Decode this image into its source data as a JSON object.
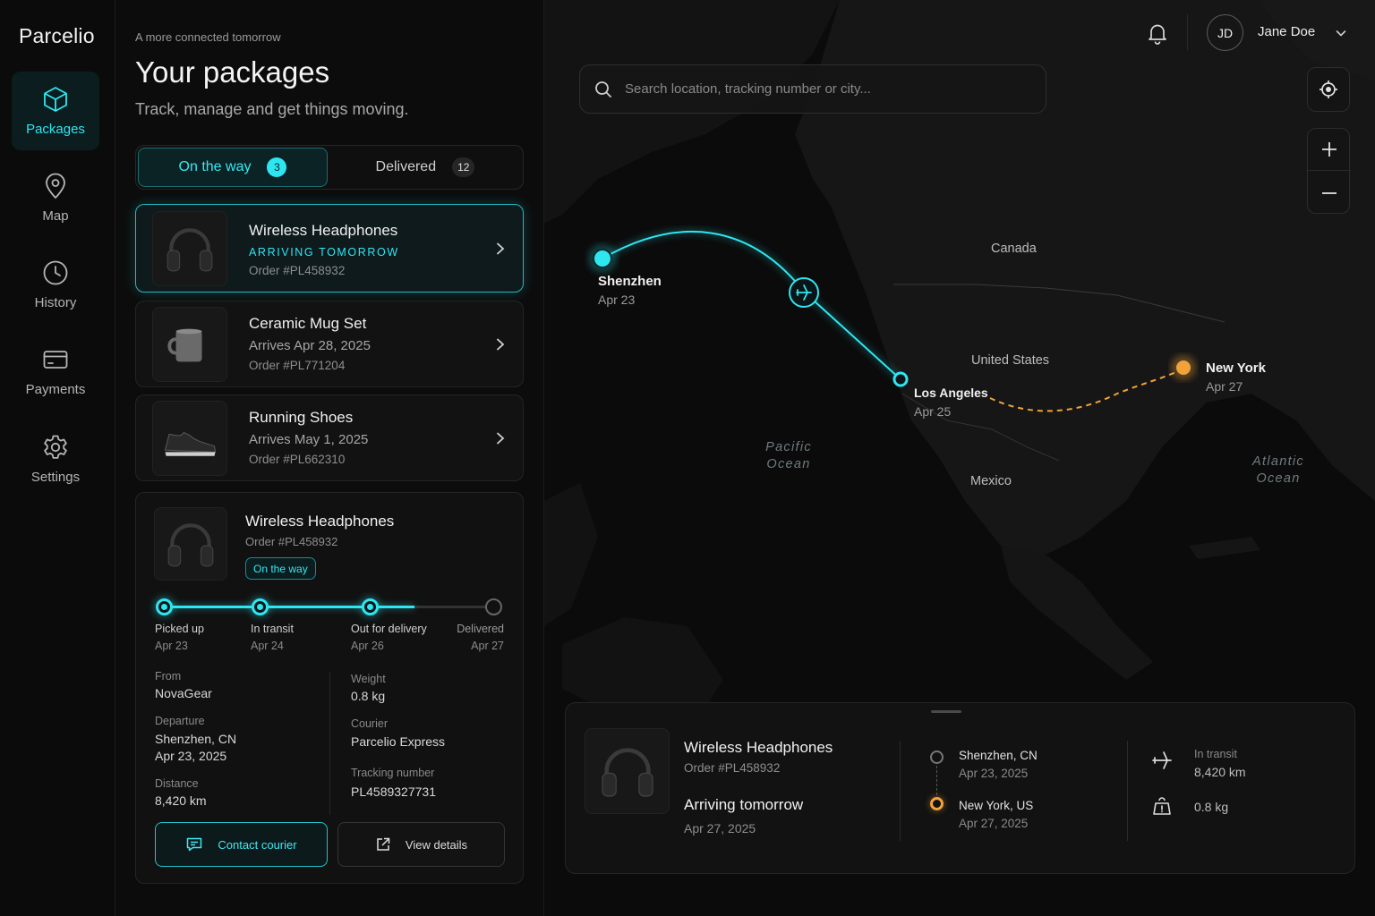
{
  "app": {
    "brand": "Parcelio"
  },
  "sidebar": {
    "items": [
      {
        "label": "Packages",
        "icon": "package-icon",
        "active": true
      },
      {
        "label": "Map",
        "icon": "map-pin-icon"
      },
      {
        "label": "History",
        "icon": "clock-icon"
      },
      {
        "label": "Payments",
        "icon": "credit-card-icon"
      },
      {
        "label": "Settings",
        "icon": "gear-icon"
      }
    ]
  },
  "header": {
    "tagline": "A more connected tomorrow",
    "title": "Your packages",
    "subtitle": "Track, manage and get things moving."
  },
  "tabs": [
    {
      "label": "On the way",
      "count": "3",
      "active": true
    },
    {
      "label": "Delivered",
      "count": "12"
    }
  ],
  "packages": [
    {
      "name": "Wireless Headphones",
      "status": "ARRIVING TOMORROW",
      "order": "Order #PL458932",
      "thumb": "headphones",
      "selected": true
    },
    {
      "name": "Ceramic Mug Set",
      "status": "Arrives Apr 28, 2025",
      "order": "Order #PL771204",
      "thumb": "mug"
    },
    {
      "name": "Running Shoes",
      "status": "Arrives May 1, 2025",
      "order": "Order #PL662310",
      "thumb": "shoe"
    }
  ],
  "detail": {
    "name": "Wireless Headphones",
    "order": "Order #PL458932",
    "badge": "On the way",
    "progress_fraction": 0.76,
    "steps": [
      {
        "label": "Picked up",
        "date": "Apr 23",
        "done": true
      },
      {
        "label": "In transit",
        "date": "Apr 24",
        "done": true
      },
      {
        "label": "Out for delivery",
        "date": "Apr 26",
        "done": true
      },
      {
        "label": "Delivered",
        "date": "Apr 27",
        "done": false
      }
    ],
    "left_fields": [
      {
        "key": "From",
        "value": "NovaGear"
      },
      {
        "key": "Departure",
        "value": "Shenzhen, CN",
        "value2": "Apr 23, 2025"
      },
      {
        "key": "Distance",
        "value": "8,420 km"
      }
    ],
    "right_fields": [
      {
        "key": "Weight",
        "value": "0.8 kg"
      },
      {
        "key": "Courier",
        "value": "Parcelio Express"
      },
      {
        "key": "Tracking number",
        "value": "PL4589327731"
      }
    ],
    "contact_label": "Contact courier",
    "view_label": "View details"
  },
  "topbar": {
    "user_initials": "JD",
    "user_name": "Jane Doe"
  },
  "search": {
    "placeholder": "Search location, tracking number or city..."
  },
  "map": {
    "labels": {
      "canada": "Canada",
      "us": "United States",
      "mexico": "Mexico"
    },
    "oceans": {
      "pacific_1": "Pacific",
      "pacific_2": "Ocean",
      "atlantic_1": "Atlantic",
      "atlantic_2": "Ocean"
    },
    "route": [
      {
        "city": "Shenzhen",
        "date": "Apr 23"
      },
      {
        "city": "Los Angeles",
        "date": "Apr 25"
      },
      {
        "city": "New York",
        "date": "Apr 27"
      }
    ],
    "colors": {
      "route_done": "#2ee6f0",
      "route_pending": "#f1a33a"
    }
  },
  "sheet": {
    "name": "Wireless Headphones",
    "order": "Order #PL458932",
    "arriving": "Arriving tomorrow",
    "arriving_date": "Apr 27, 2025",
    "from_place": "Shenzhen, CN",
    "from_date": "Apr 23, 2025",
    "to_place": "New York, US",
    "to_date": "Apr 27, 2025",
    "mode_label": "In transit",
    "distance": "8,420 km",
    "weight": "0.8 kg"
  }
}
